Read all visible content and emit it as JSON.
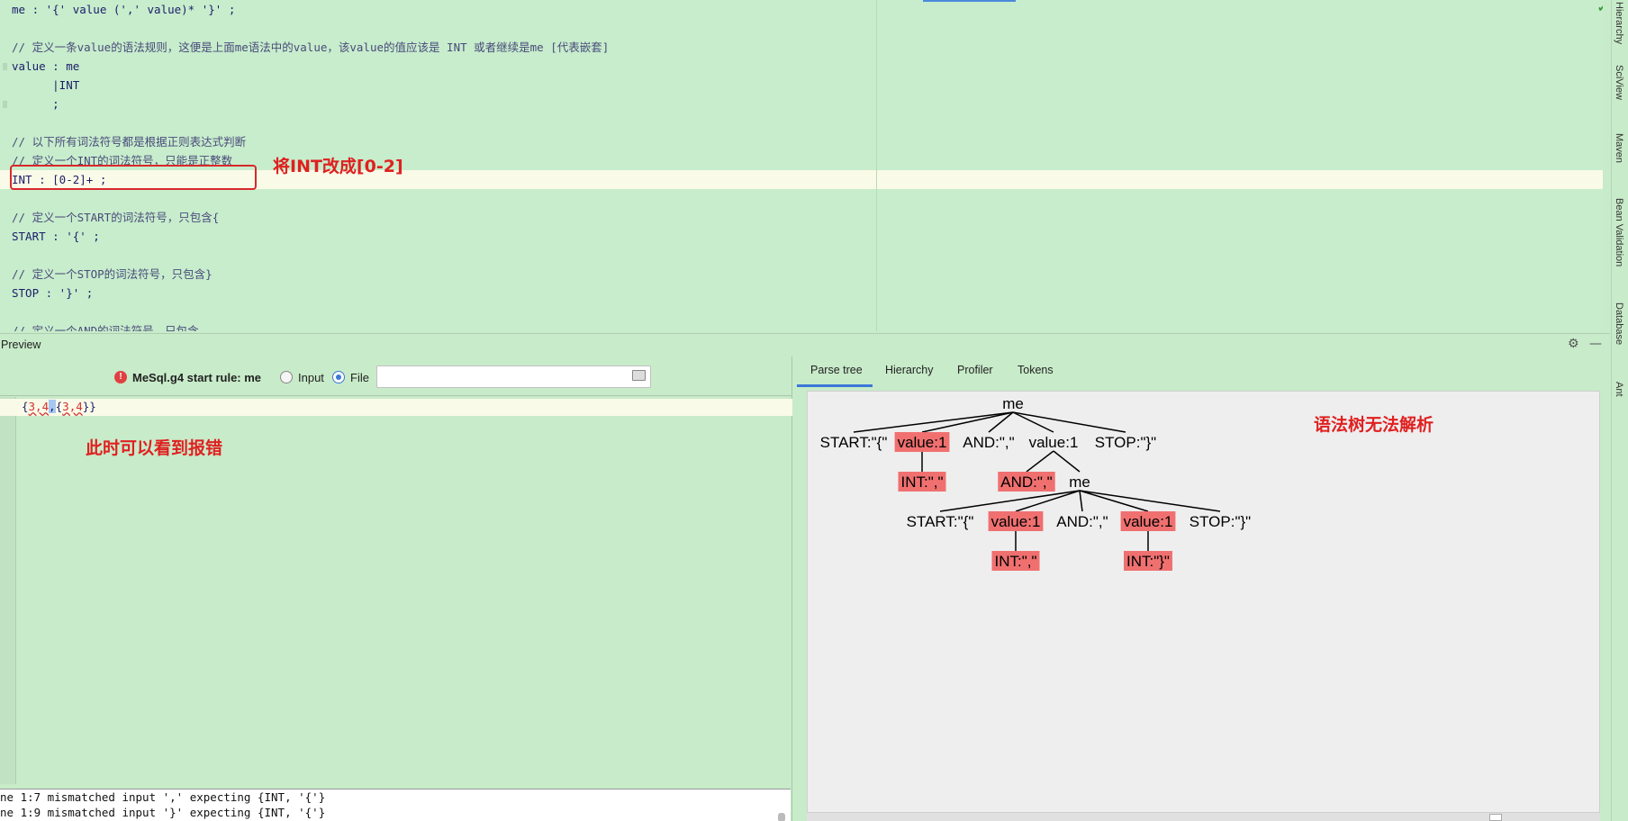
{
  "editor": {
    "lines": [
      {
        "text": "me : '{' value (',' value)* '}' ;",
        "kind": "rule"
      },
      {
        "text": "",
        "kind": "rule"
      },
      {
        "text": "// 定义一条value的语法规则，这便是上面me语法中的value，该value的值应该是 INT 或者继续是me [代表嵌套]",
        "kind": "comment"
      },
      {
        "text": "value : me",
        "kind": "rule"
      },
      {
        "text": "      |INT",
        "kind": "rule"
      },
      {
        "text": "      ;",
        "kind": "rule"
      },
      {
        "text": "",
        "kind": "rule"
      },
      {
        "text": "// 以下所有词法符号都是根据正则表达式判断",
        "kind": "comment"
      },
      {
        "text": "// 定义一个INT的词法符号，只能是正整数",
        "kind": "comment"
      },
      {
        "text": "INT : [0-2]+ ;",
        "kind": "rule"
      },
      {
        "text": "",
        "kind": "rule"
      },
      {
        "text": "// 定义一个START的词法符号，只包含{",
        "kind": "comment"
      },
      {
        "text": "START : '{' ;",
        "kind": "rule"
      },
      {
        "text": "",
        "kind": "rule"
      },
      {
        "text": "// 定义一个STOP的词法符号，只包含}",
        "kind": "comment"
      },
      {
        "text": "STOP : '}' ;",
        "kind": "rule"
      },
      {
        "text": "",
        "kind": "rule"
      },
      {
        "text": "// 定义一个AND的词法符号，只包含,",
        "kind": "comment"
      }
    ],
    "annotation": "将INT改成[0-2]"
  },
  "right_strip": [
    "Hierarchy",
    "SciView",
    "Maven",
    "Bean Validation",
    "Database",
    "Ant"
  ],
  "preview": {
    "title": "Preview",
    "rule_label": "MeSql.g4 start rule: me",
    "radio_input": "Input",
    "radio_file": "File",
    "file_path": "",
    "input_parts": [
      {
        "t": "{",
        "cls": ""
      },
      {
        "t": "3,4",
        "cls": "err"
      },
      {
        "t": ",",
        "cls": "sel"
      },
      {
        "t": "{",
        "cls": ""
      },
      {
        "t": "3,4",
        "cls": "err"
      },
      {
        "t": "}}",
        "cls": ""
      }
    ],
    "annotation": "此时可以看到报错",
    "console": [
      "ne 1:7 mismatched input ',' expecting {INT, '{'}",
      "ne 1:9 mismatched input '}' expecting {INT, '{'}"
    ],
    "tabs": [
      "Parse tree",
      "Hierarchy",
      "Profiler",
      "Tokens"
    ],
    "tree_annotation": "语法树无法解析"
  },
  "colors": {
    "error_node": "#f07070",
    "annotation_red": "#e02020",
    "accent_blue": "#3b78d8"
  },
  "parse_tree": {
    "nodes": [
      {
        "id": "n0",
        "label": "me",
        "error": false
      },
      {
        "id": "n1",
        "label": "START:\"{\"",
        "error": false,
        "parent": "n0"
      },
      {
        "id": "n2",
        "label": "value:1",
        "error": true,
        "parent": "n0"
      },
      {
        "id": "n3",
        "label": "AND:\",\"",
        "error": false,
        "parent": "n0"
      },
      {
        "id": "n4",
        "label": "value:1",
        "error": false,
        "parent": "n0"
      },
      {
        "id": "n5",
        "label": "STOP:\"}\"",
        "error": false,
        "parent": "n0"
      },
      {
        "id": "n6",
        "label": "INT:\",\"",
        "error": true,
        "parent": "n2"
      },
      {
        "id": "n7",
        "label": "AND:\",\"",
        "error": true,
        "parent": "n4"
      },
      {
        "id": "n8",
        "label": "me",
        "error": false,
        "parent": "n4"
      },
      {
        "id": "n9",
        "label": "START:\"{\"",
        "error": false,
        "parent": "n8"
      },
      {
        "id": "n10",
        "label": "value:1",
        "error": true,
        "parent": "n8"
      },
      {
        "id": "n11",
        "label": "AND:\",\"",
        "error": false,
        "parent": "n8"
      },
      {
        "id": "n12",
        "label": "value:1",
        "error": true,
        "parent": "n8"
      },
      {
        "id": "n13",
        "label": "STOP:\"}\"",
        "error": false,
        "parent": "n8"
      },
      {
        "id": "n14",
        "label": "INT:\",\"",
        "error": true,
        "parent": "n10"
      },
      {
        "id": "n15",
        "label": "INT:\"}\"",
        "error": true,
        "parent": "n12"
      }
    ]
  }
}
